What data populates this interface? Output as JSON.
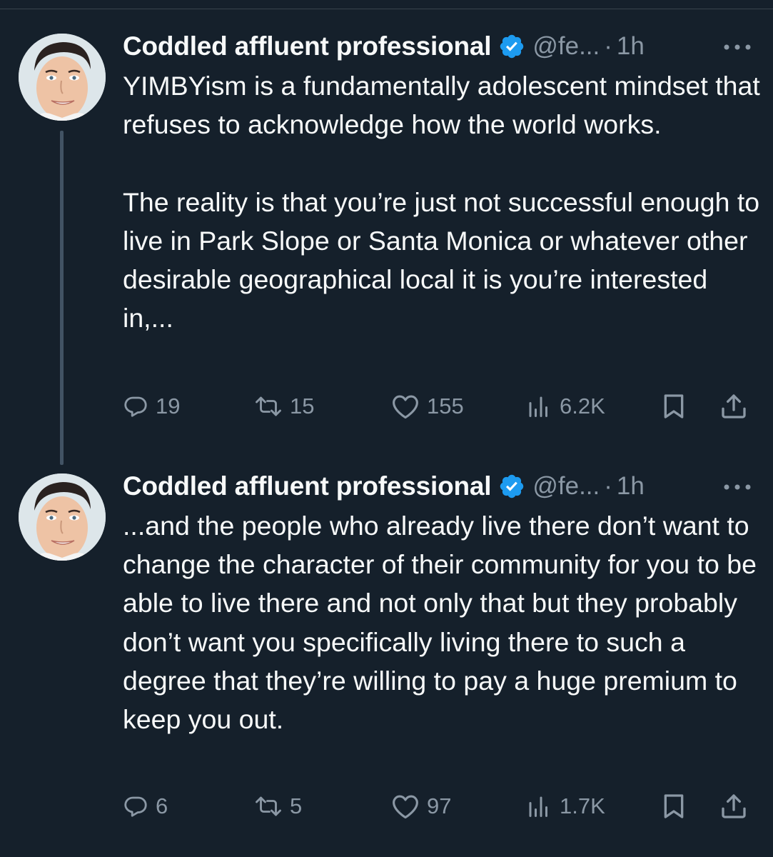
{
  "tweets": [
    {
      "author_name": "Coddled affluent professional",
      "handle": "@fe...",
      "separator": "·",
      "time": "1h",
      "text": "YIMBYism is a fundamentally adolescent mindset that refuses to acknowledge how the world works.\n\nThe reality is that you’re just not successful enough to live in Park Slope or Santa Monica or whatever other desirable geographical local it is you’re interested in,...",
      "replies": "19",
      "reposts": "15",
      "likes": "155",
      "views": "6.2K"
    },
    {
      "author_name": "Coddled affluent professional",
      "handle": "@fe...",
      "separator": "·",
      "time": "1h",
      "text": "...and the people who already live there don’t want to change the character of their community for you to be able to live there and not only that but they probably don’t want you specifically living there to such a degree that they’re willing to pay a huge premium to keep you out.",
      "replies": "6",
      "reposts": "5",
      "likes": "97",
      "views": "1.7K"
    }
  ],
  "colors": {
    "background": "#15202b",
    "text": "#f7f9f9",
    "secondary": "#8b98a5",
    "verified": "#1d9bf0",
    "thread_line": "#425364"
  },
  "icons": [
    "verified-badge-icon",
    "more-icon",
    "reply-icon",
    "repost-icon",
    "like-icon",
    "views-icon",
    "bookmark-icon",
    "share-icon"
  ]
}
